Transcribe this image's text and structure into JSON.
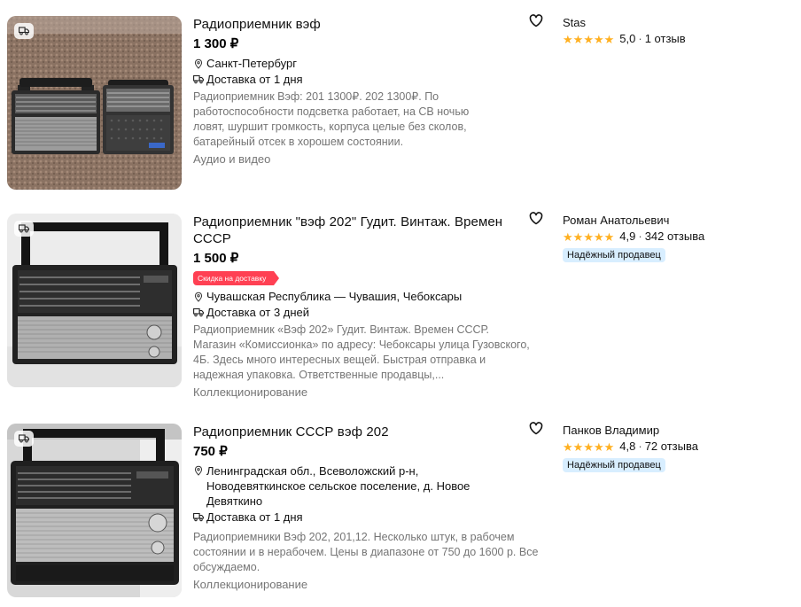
{
  "listings": [
    {
      "title": "Радиоприемник вэф",
      "price": "1 300 ₽",
      "location": "Санкт-Петербург",
      "delivery": "Доставка от 1 дня",
      "description": "Радиоприемник Вэф: 201 1300₽. 202 1300₽. По работоспособности подсветка работает, на СВ ночью ловят, шуршит громкость, корпуса целые без сколов, батарейный отсек в хорошем состоянии.",
      "category": "Аудио и видео",
      "seller": {
        "name": "Stas",
        "rating": "5,0",
        "reviews": "1 отзыв"
      }
    },
    {
      "title": "Радиоприемник \"вэф 202\" Гудит. Винтаж. Времен СССР",
      "price": "1 500 ₽",
      "discount_badge": "Скидка на доставку",
      "location": "Чувашская Республика — Чувашия, Чебоксары",
      "delivery": "Доставка от 3 дней",
      "description": "Радиоприемник «Вэф 202» Гудит. Винтаж. Времен СССР. Магазин «Комиссионка» по адресу: Чебоксары улица Гузовского, 4Б. Здесь много интересных вещей. Быстрая отправка и надежная упаковка. Ответственные продавцы,...",
      "category": "Коллекционирование",
      "seller": {
        "name": "Роман Анатольевич",
        "rating": "4,9",
        "reviews": "342 отзыва",
        "badge": "Надёжный продавец"
      }
    },
    {
      "title": "Радиоприемник СССР вэф 202",
      "price": "750 ₽",
      "location": "Ленинградская обл., Всеволожский р-н, Новодевяткинское сельское поселение, д. Новое Девяткино",
      "delivery": "Доставка от 1 дня",
      "description": "Радиоприемники Вэф 202, 201,12. Несколько штук, в рабочем состоянии и в нерабочем. Цены в диапазоне от 750 до 1600 р. Все обсуждаемо.",
      "category": "Коллекционирование",
      "seller": {
        "name": "Панков Владимир",
        "rating": "4,8",
        "reviews": "72 отзыва",
        "badge": "Надёжный продавец"
      }
    }
  ],
  "icons": {
    "favorite": "heart-outline-icon",
    "location": "map-pin-icon",
    "delivery": "delivery-truck-icon",
    "star": "star-icon"
  },
  "colors": {
    "star": "#ffb021",
    "discount": "#ff4053",
    "trusted_badge_bg": "#d8eeff",
    "muted_text": "#757575"
  }
}
